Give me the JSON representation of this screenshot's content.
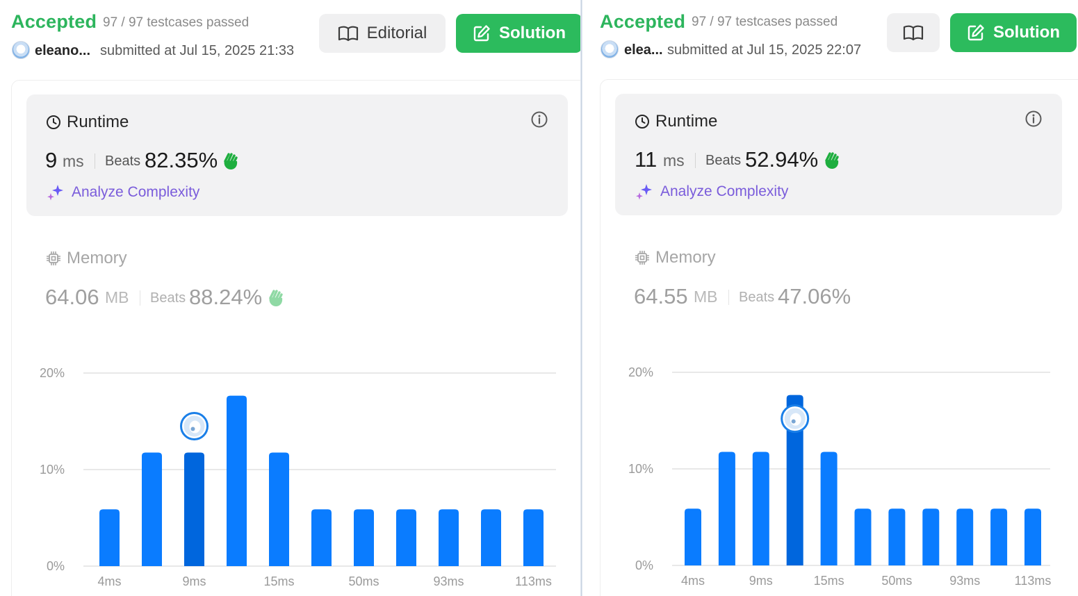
{
  "left": {
    "status": "Accepted",
    "testcases": "97 / 97 testcases passed",
    "user": "eleano...",
    "submitted": "submitted at Jul 15, 2025 21:33",
    "editorial_label": "Editorial",
    "solution_label": "Solution",
    "runtime": {
      "title": "Runtime",
      "value": "9",
      "unit": "ms",
      "beats_label": "Beats",
      "beats_pct": "82.35%",
      "analyze_label": "Analyze Complexity"
    },
    "memory": {
      "title": "Memory",
      "value": "64.06",
      "unit": "MB",
      "beats_label": "Beats",
      "beats_pct": "88.24%"
    }
  },
  "right": {
    "status": "Accepted",
    "testcases": "97 / 97 testcases passed",
    "user": "elea...",
    "submitted": "submitted at Jul 15, 2025 22:07",
    "solution_label": "Solution",
    "runtime": {
      "title": "Runtime",
      "value": "11",
      "unit": "ms",
      "beats_label": "Beats",
      "beats_pct": "52.94%",
      "analyze_label": "Analyze Complexity"
    },
    "memory": {
      "title": "Memory",
      "value": "64.55",
      "unit": "MB",
      "beats_label": "Beats",
      "beats_pct": "47.06%"
    }
  },
  "colors": {
    "accepted": "#2db55d",
    "solution_button": "#2cbb5d",
    "bar": "#0a7cff",
    "bar_highlight": "#0066dd",
    "analyze": "#7a5cdb"
  },
  "icons": {
    "editorial": "book-icon",
    "solution": "edit-icon",
    "runtime": "clock-icon",
    "memory": "chip-icon",
    "info": "info-icon",
    "analyze": "sparkles-icon",
    "beats": "clap-icon"
  },
  "chart_data": [
    {
      "type": "bar",
      "title": "",
      "xlabel": "",
      "ylabel": "",
      "ylim": [
        0,
        20
      ],
      "yticks": [
        "0%",
        "10%",
        "20%"
      ],
      "xtick_labels": [
        "4ms",
        "9ms",
        "15ms",
        "50ms",
        "93ms",
        "113ms"
      ],
      "values": [
        5.88,
        11.76,
        11.76,
        17.65,
        11.76,
        5.88,
        5.88,
        5.88,
        5.88,
        5.88,
        5.88
      ],
      "highlight_index": 2,
      "grid": true
    },
    {
      "type": "bar",
      "title": "",
      "xlabel": "",
      "ylabel": "",
      "ylim": [
        0,
        20
      ],
      "yticks": [
        "0%",
        "10%",
        "20%"
      ],
      "xtick_labels": [
        "4ms",
        "9ms",
        "15ms",
        "50ms",
        "93ms",
        "113ms"
      ],
      "values": [
        5.88,
        11.76,
        11.76,
        17.65,
        11.76,
        5.88,
        5.88,
        5.88,
        5.88,
        5.88,
        5.88
      ],
      "highlight_index": 3,
      "grid": true
    }
  ]
}
